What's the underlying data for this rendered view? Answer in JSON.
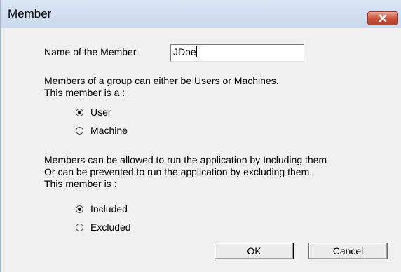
{
  "window": {
    "title": "Member",
    "close_icon": "close-icon"
  },
  "form": {
    "name_label": "Name of the Member.",
    "name_value": "JDoe",
    "type_intro_line1": "Members of a group can either be Users or Machines.",
    "type_intro_line2": "This member is a :",
    "type_options": [
      {
        "label": "User",
        "checked": true
      },
      {
        "label": "Machine",
        "checked": false
      }
    ],
    "inclusion_intro_line1": "Members can be allowed to run the application by Including them",
    "inclusion_intro_line2": "Or can be prevented to run the application by excluding them.",
    "inclusion_intro_line3": "This member is :",
    "inclusion_options": [
      {
        "label": "Included",
        "checked": true
      },
      {
        "label": "Excluded",
        "checked": false
      }
    ]
  },
  "buttons": {
    "ok_label": "OK",
    "cancel_label": "Cancel"
  },
  "colors": {
    "close_button": "#c9503a",
    "title_bar": "#c9d8ec",
    "dialog_background": "#f0f0f0"
  }
}
